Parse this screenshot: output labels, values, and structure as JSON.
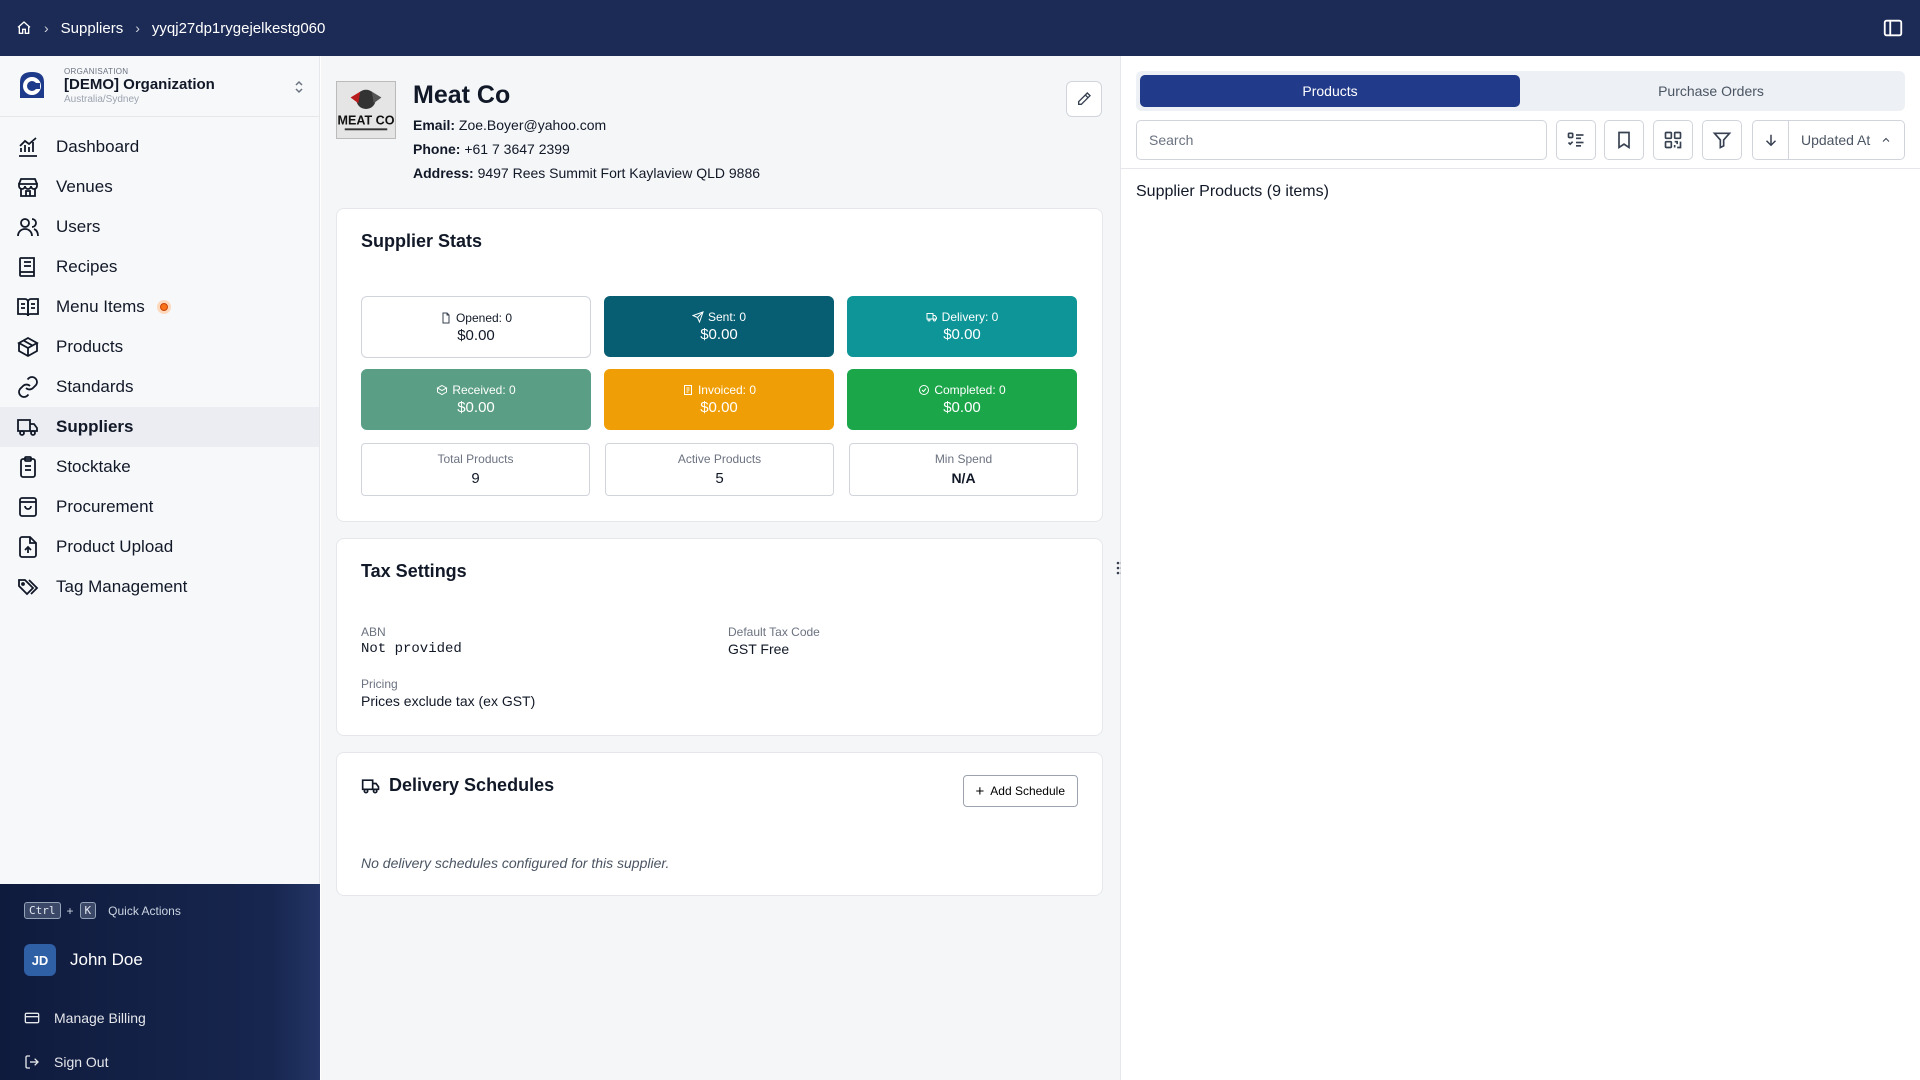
{
  "breadcrumb": {
    "section": "Suppliers",
    "current": "yyqj27dp1rygejelkestg060"
  },
  "org": {
    "small_label": "ORGANISATION",
    "name": "[DEMO] Organization",
    "timezone": "Australia/Sydney"
  },
  "nav": [
    {
      "label": "Dashboard",
      "icon": "chart-icon"
    },
    {
      "label": "Venues",
      "icon": "store-icon"
    },
    {
      "label": "Users",
      "icon": "users-icon"
    },
    {
      "label": "Recipes",
      "icon": "book-icon"
    },
    {
      "label": "Menu Items",
      "icon": "menu-book-icon"
    },
    {
      "label": "Products",
      "icon": "box-icon"
    },
    {
      "label": "Standards",
      "icon": "link-icon"
    },
    {
      "label": "Suppliers",
      "icon": "truck-icon"
    },
    {
      "label": "Stocktake",
      "icon": "clipboard-icon"
    },
    {
      "label": "Procurement",
      "icon": "bag-icon"
    },
    {
      "label": "Product Upload",
      "icon": "upload-icon"
    },
    {
      "label": "Tag Management",
      "icon": "tags-icon"
    }
  ],
  "quick_actions": {
    "key1": "Ctrl",
    "plus": "+",
    "key2": "K",
    "label": "Quick Actions"
  },
  "user": {
    "initials": "JD",
    "name": "John Doe"
  },
  "bottom_links": {
    "billing": "Manage Billing",
    "signout": "Sign Out"
  },
  "supplier": {
    "logo_text": "MEAT CO",
    "name": "Meat Co",
    "email_label": "Email:",
    "email": "Zoe.Boyer@yahoo.com",
    "phone_label": "Phone:",
    "phone": "+61 7 3647 2399",
    "address_label": "Address:",
    "address": "9497 Rees Summit Fort Kaylaview QLD 9886"
  },
  "stats": {
    "title": "Supplier Stats",
    "opened": {
      "label": "Opened: 0",
      "value": "$0.00",
      "color": "#ffffff"
    },
    "sent": {
      "label": "Sent: 0",
      "value": "$0.00",
      "color": "#075e73"
    },
    "delivery": {
      "label": "Delivery: 0",
      "value": "$0.00",
      "color": "#0e9598"
    },
    "received": {
      "label": "Received: 0",
      "value": "$0.00",
      "color": "#5a9e85"
    },
    "invoiced": {
      "label": "Invoiced: 0",
      "value": "$0.00",
      "color": "#f09e05"
    },
    "completed": {
      "label": "Completed: 0",
      "value": "$0.00",
      "color": "#1ca64a"
    },
    "total_products": {
      "label": "Total Products",
      "value": "9"
    },
    "active_products": {
      "label": "Active Products",
      "value": "5"
    },
    "min_spend": {
      "label": "Min Spend",
      "value": "N/A"
    }
  },
  "tax": {
    "title": "Tax Settings",
    "abn_label": "ABN",
    "abn": "Not provided",
    "taxcode_label": "Default Tax Code",
    "taxcode": "GST Free",
    "pricing_label": "Pricing",
    "pricing": "Prices exclude tax (ex GST)"
  },
  "delivery": {
    "title": "Delivery Schedules",
    "add_label": "Add Schedule",
    "empty": "No delivery schedules configured for this supplier."
  },
  "right": {
    "tabs": [
      "Products",
      "Purchase Orders"
    ],
    "search_placeholder": "Search",
    "sort_field": "Updated At",
    "count_label": "Supplier Products (9 items)"
  },
  "colors": {
    "topbar": "#1c2b55",
    "accent": "#223a8a"
  }
}
